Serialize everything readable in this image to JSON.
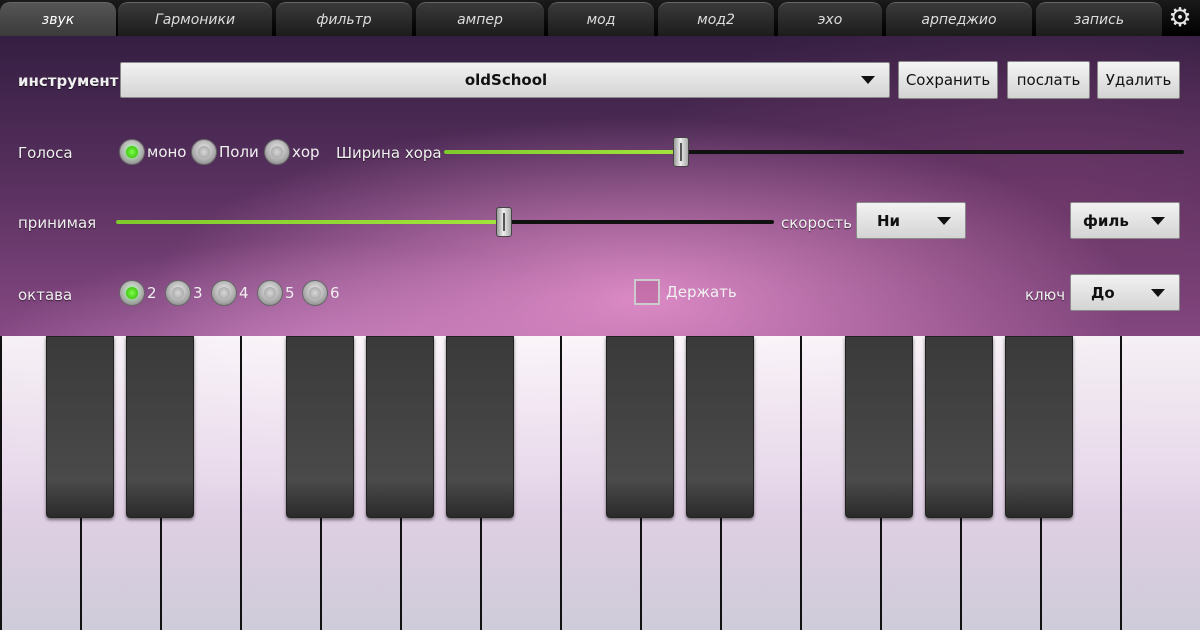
{
  "tabs": [
    {
      "label": "звук",
      "active": true
    },
    {
      "label": "Гармоники",
      "active": false
    },
    {
      "label": "фильтр",
      "active": false
    },
    {
      "label": "ампер",
      "active": false
    },
    {
      "label": "мод",
      "active": false
    },
    {
      "label": "мод2",
      "active": false
    },
    {
      "label": "эхо",
      "active": false
    },
    {
      "label": "арпеджио",
      "active": false
    },
    {
      "label": "запись",
      "active": false
    }
  ],
  "settings_icon": "gear-icon",
  "instrument": {
    "label": "инструмент",
    "value": "oldSchool",
    "save_label": "Сохранить",
    "send_label": "послать",
    "delete_label": "Удалить"
  },
  "voices": {
    "label": "Голоса",
    "options": [
      {
        "label": "моно",
        "selected": true
      },
      {
        "label": "Поли",
        "selected": false
      },
      {
        "label": "хор",
        "selected": false
      }
    ],
    "chorus_width_label": "Ширина хора",
    "chorus_width_value": 0.32
  },
  "accept": {
    "label": "принимая",
    "value": 0.59,
    "velocity_label": "скорость",
    "velocity_value": "Ни",
    "filter_value": "филь"
  },
  "octave": {
    "label": "октава",
    "options": [
      {
        "label": "2",
        "selected": true
      },
      {
        "label": "3",
        "selected": false
      },
      {
        "label": "4",
        "selected": false
      },
      {
        "label": "5",
        "selected": false
      },
      {
        "label": "6",
        "selected": false
      }
    ],
    "hold_label": "Держать",
    "hold_checked": false,
    "key_label": "ключ",
    "key_value": "До"
  },
  "colors": {
    "accent_green": "#7ec92c",
    "radio_on": "#2fb300"
  }
}
